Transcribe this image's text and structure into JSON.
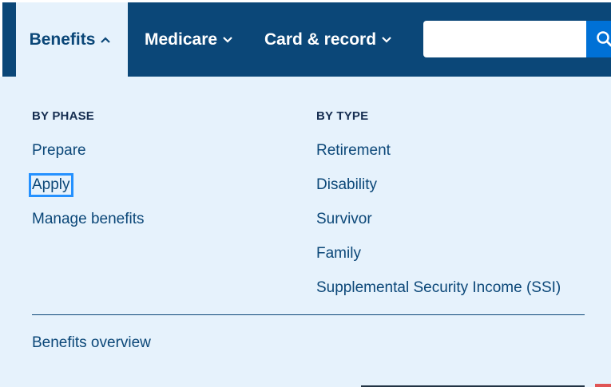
{
  "nav": {
    "items": [
      {
        "label": "Benefits",
        "expanded": true
      },
      {
        "label": "Medicare",
        "expanded": false
      },
      {
        "label": "Card & record",
        "expanded": false
      }
    ],
    "search": {
      "value": "",
      "placeholder": ""
    }
  },
  "dropdown": {
    "by_phase": {
      "heading": "BY PHASE",
      "links": [
        "Prepare",
        "Apply",
        "Manage benefits"
      ]
    },
    "by_type": {
      "heading": "BY TYPE",
      "links": [
        "Retirement",
        "Disability",
        "Survivor",
        "Family",
        "Supplemental Security Income (SSI)"
      ]
    },
    "overview_link": "Benefits overview"
  },
  "colors": {
    "nav_background": "#0b4778",
    "dropdown_background": "#e6f2fc",
    "link": "#0b4778",
    "search_button": "#0071d6",
    "focus_ring": "#2491ff"
  }
}
